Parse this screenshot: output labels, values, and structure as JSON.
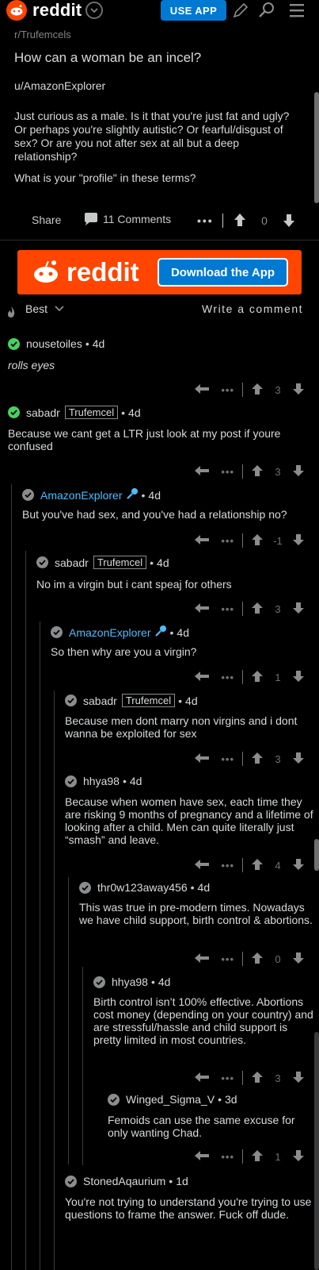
{
  "header": {
    "brand": "reddit",
    "use_app_label": "USE APP"
  },
  "post": {
    "subreddit": "r/Trufemcels",
    "title": "How can a woman be an incel?",
    "author": "u/AmazonExplorer",
    "body": [
      "Just curious as a male. Is it that you're just fat and ugly? Or perhaps you're slightly autistic? Or fearful/disgust of sex? Or are you not after sex at all but a deep relationship?",
      "What is your \"profile\" in these terms?"
    ],
    "share_label": "Share",
    "comments_label": "11 Comments",
    "score": "0"
  },
  "banner": {
    "brand": "reddit",
    "button_label": "Download the App"
  },
  "sort": {
    "label": "Best",
    "write_comment": "Write a comment"
  },
  "comments": [
    {
      "author": "nousetoiles",
      "flair": "",
      "age": "4d",
      "body": "rolls eyes",
      "score": "3",
      "italic": true
    },
    {
      "author": "sabadr",
      "flair": "Trufemcel",
      "age": "4d",
      "body": "Because we cant get a LTR just look at my post if youre confused",
      "score": "3"
    },
    {
      "author": "AmazonExplorer",
      "flair": "",
      "age": "4d",
      "body": "But you've had sex, and you've had a relationship no?",
      "score": "-1"
    },
    {
      "author": "sabadr",
      "flair": "Trufemcel",
      "age": "4d",
      "body": "No im a virgin but i cant speaj for others",
      "score": "3"
    },
    {
      "author": "AmazonExplorer",
      "flair": "",
      "age": "4d",
      "body": "So then why are you a virgin?",
      "score": "1"
    },
    {
      "author": "sabadr",
      "flair": "Trufemcel",
      "age": "4d",
      "body": "Because men dont marry non virgins and i dont wanna be exploited for sex",
      "score": "3"
    },
    {
      "author": "hhya98",
      "flair": "",
      "age": "4d",
      "body": "Because when women have sex, each time they are risking 9 months of pregnancy and a lifetime of looking after a child. Men can quite literally just “smash” and leave.",
      "score": "4"
    },
    {
      "author": "thr0w123away456",
      "flair": "",
      "age": "4d",
      "body": "This was true in pre-modern times. Nowadays we have child support, birth control & abortions.",
      "score": "0"
    },
    {
      "author": "hhya98",
      "flair": "",
      "age": "4d",
      "body": "Birth control isn’t 100% effective. Abortions cost money (depending on your country) and are stressful/hassle and child support is pretty limited in most countries.",
      "score": "3"
    },
    {
      "author": "Winged_Sigma_V",
      "flair": "",
      "age": "3d",
      "body": "Femoids can use the same excuse for only wanting Chad.",
      "score": "1"
    },
    {
      "author": "StonedAqaurium",
      "flair": "",
      "age": "1d",
      "body": "You're not trying to understand you're trying to use questions to frame the answer. Fuck off dude.",
      "score": ""
    }
  ],
  "colors": {
    "background": "#000000",
    "brand_orange": "#ff4500",
    "app_blue": "#0079d3",
    "op_blue": "#4fbcff",
    "check_green": "#46d160"
  }
}
